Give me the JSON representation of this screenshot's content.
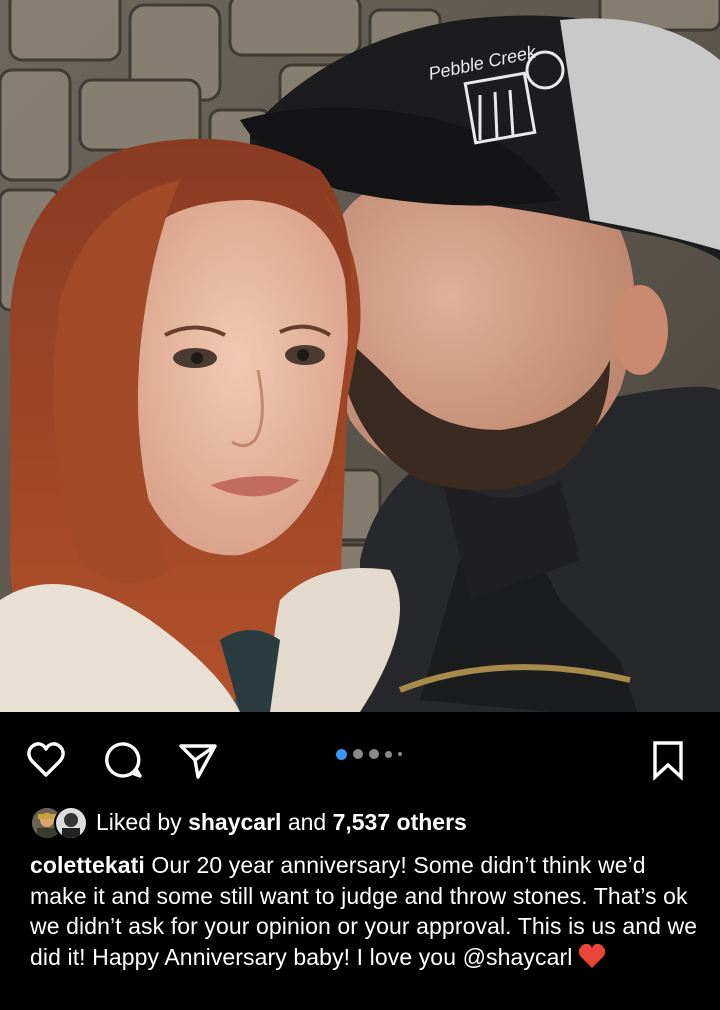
{
  "post": {
    "photo_label": "Pebble Creek",
    "carousel": {
      "count": 5,
      "active": 1
    },
    "actions": {
      "like_icon": "heart-outline-icon",
      "comment_icon": "comment-bubble-icon",
      "share_icon": "paper-plane-icon",
      "save_icon": "bookmark-icon"
    },
    "likes": {
      "prefix": "Liked by",
      "user": "shaycarl",
      "conjunction": "and",
      "others": "7,537 others"
    },
    "caption": {
      "username": "colettekati",
      "text": "Our 20 year anniversary! Some didn’t think we’d make it and some still want to judge and throw stones. That’s ok we didn’t ask for your opinion or your approval. This is us and we did it! Happy Anniversary baby! I love you @shaycarl",
      "emoji": "red-heart-emoji"
    },
    "colors": {
      "background": "#000000",
      "text": "#ffffff",
      "active_dot": "#3897f0",
      "heart": "#e8453c"
    }
  }
}
